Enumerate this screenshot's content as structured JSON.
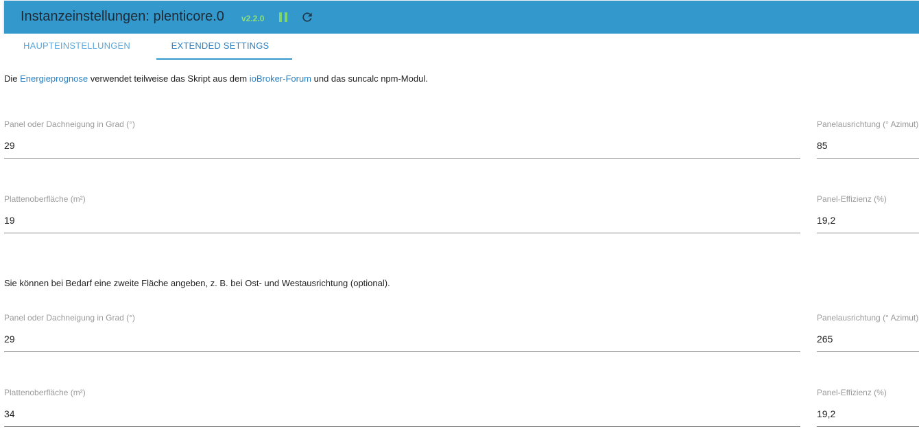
{
  "header": {
    "title": "Instanzeinstellungen: plenticore.0",
    "version": "v2.2.0"
  },
  "tabs": [
    {
      "label": "HAUPTEINSTELLUNGEN"
    },
    {
      "label": "EXTENDED SETTINGS"
    }
  ],
  "intro": {
    "prefix": "Die ",
    "link1": "Energieprognose",
    "middle": " verwendet teilweise das Skript aus dem ",
    "link2": "ioBroker-Forum",
    "suffix": " und das suncalc npm-Modul."
  },
  "section1": {
    "tilt_label": "Panel oder Dachneigung in Grad (°)",
    "tilt_value": "29",
    "azimuth_label": "Panelausrichtung (° Azimut)",
    "azimuth_value": "85",
    "area_label": "Plattenoberfläche (m²)",
    "area_value": "19",
    "efficiency_label": "Panel-Effizienz (%)",
    "efficiency_value": "19,2"
  },
  "second_surface_note": "Sie können bei Bedarf eine zweite Fläche angeben, z. B. bei Ost- und Westausrichtung (optional).",
  "section2": {
    "tilt_label": "Panel oder Dachneigung in Grad (°)",
    "tilt_value": "29",
    "azimuth_label": "Panelausrichtung (° Azimut)",
    "azimuth_value": "265",
    "area_label": "Plattenoberfläche (m²)",
    "area_value": "34",
    "efficiency_label": "Panel-Effizienz (%)",
    "efficiency_value": "19,2"
  },
  "colors": {
    "header_bg": "#3399cc",
    "link": "#2b7fc0",
    "version": "#8ee07a"
  },
  "icons": [
    "pause-icon",
    "reload-icon"
  ]
}
